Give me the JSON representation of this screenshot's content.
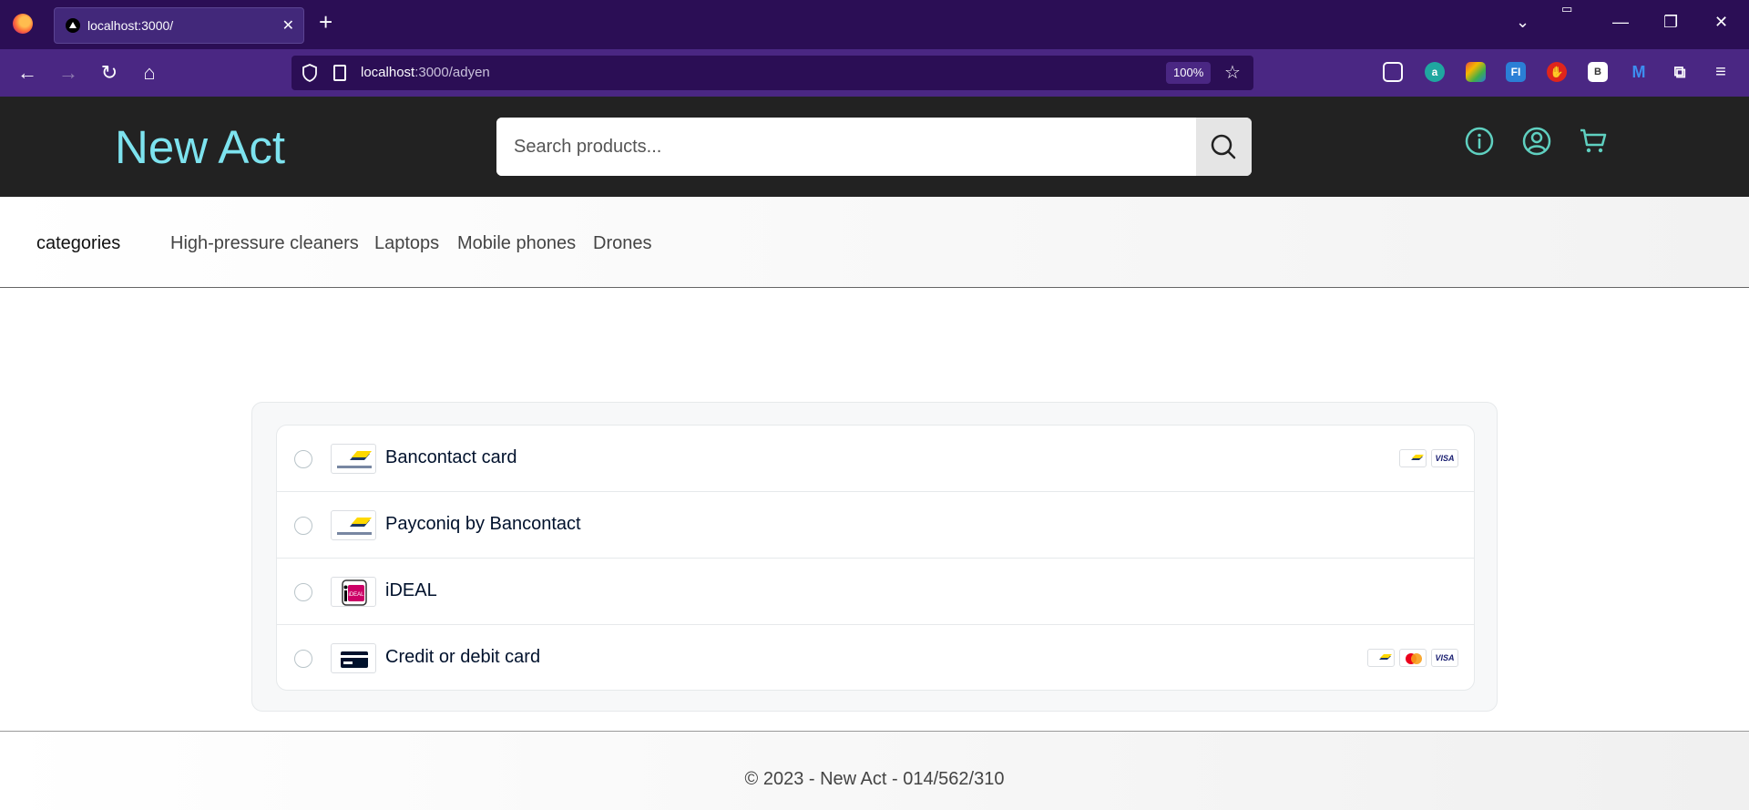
{
  "browser": {
    "tab_title": "localhost:3000/",
    "url_host": "localhost",
    "url_path": ":3000/adyen",
    "zoom": "100%"
  },
  "header": {
    "brand": "New Act",
    "search_placeholder": "Search products..."
  },
  "categories": {
    "title": "categories",
    "items": [
      "High-pressure cleaners",
      "Laptops",
      "Mobile phones",
      "Drones"
    ]
  },
  "payment_methods": [
    {
      "name": "Bancontact card",
      "logo": "bancontact-logo",
      "brands": [
        "bancontact",
        "visa"
      ]
    },
    {
      "name": "Payconiq by Bancontact",
      "logo": "bancontact-logo",
      "brands": []
    },
    {
      "name": "iDEAL",
      "logo": "ideal-logo",
      "brands": []
    },
    {
      "name": "Credit or debit card",
      "logo": "card-logo",
      "brands": [
        "bancontact",
        "mastercard",
        "visa"
      ]
    }
  ],
  "brand_labels": {
    "visa": "VISA",
    "ideal": "iDEAL"
  },
  "footer": {
    "text": "© 2023 - New Act - 014/562/310"
  },
  "colors": {
    "browser_tabbar": "#2b0e55",
    "browser_navbar": "#4a2783",
    "header_bg": "#222222",
    "brand_color": "#7de3ef",
    "icon_color": "#5fd0c0"
  }
}
